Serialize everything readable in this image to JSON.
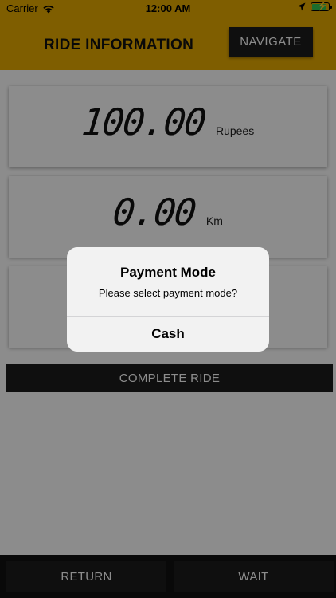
{
  "status_bar": {
    "carrier": "Carrier",
    "time": "12:00 AM",
    "battery_level": 0.85
  },
  "header": {
    "title": "RIDE INFORMATION",
    "navigate_label": "NAVIGATE"
  },
  "readings": {
    "fare_value": "100.00",
    "fare_unit": "Rupees",
    "distance_value": "0.00",
    "distance_unit": "Km"
  },
  "actions": {
    "complete_label": "COMPLETE RIDE",
    "return_label": "RETURN",
    "wait_label": "WAIT"
  },
  "alert": {
    "title": "Payment Mode",
    "message": "Please select payment mode?",
    "option_cash": "Cash"
  },
  "colors": {
    "accent": "#e8ab00",
    "button_dark": "#1c1c1c",
    "battery_green": "#33c653"
  }
}
